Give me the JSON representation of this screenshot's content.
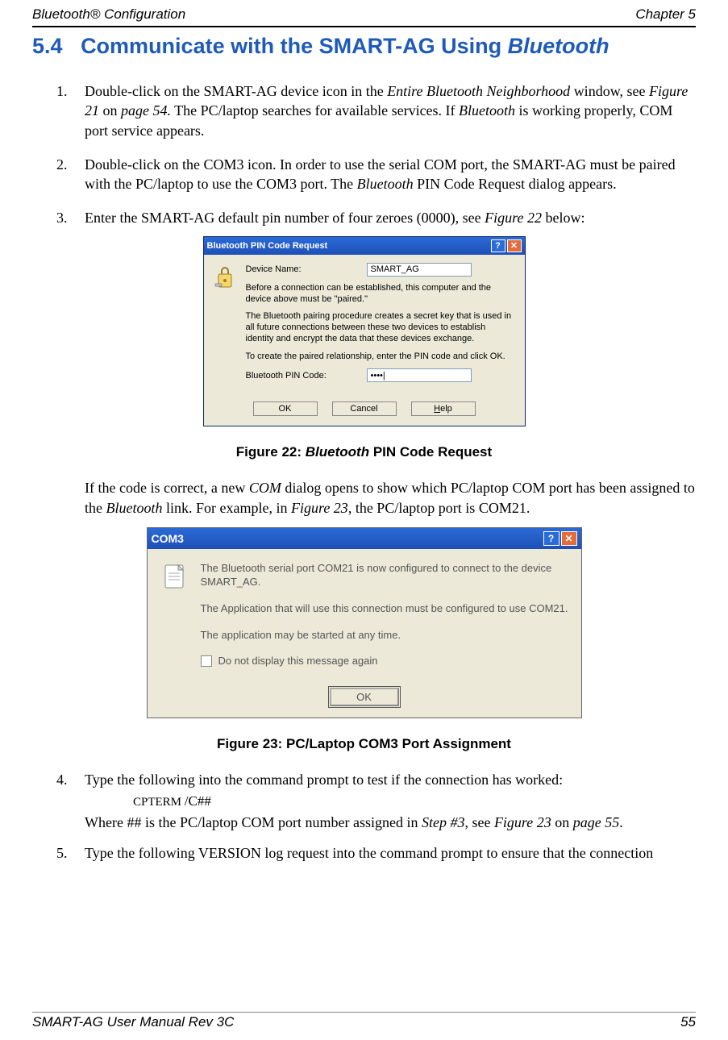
{
  "header": {
    "left": "Bluetooth® Configuration",
    "right": "Chapter 5"
  },
  "section": {
    "number": "5.4",
    "title_plain": "Communicate with the SMART-AG Using ",
    "title_italic": "Bluetooth"
  },
  "steps": {
    "s1": {
      "num": "1.",
      "pre": "Double-click on the SMART-AG device icon in the ",
      "it1": "Entire Bluetooth Neighborhood",
      "mid1": " window, see ",
      "it2": "Figure 21",
      "mid2": " on ",
      "it3": "page 54.",
      "mid3": " The PC/laptop searches for available services. If ",
      "it4": "Bluetooth",
      "post": " is working properly, COM port service appears."
    },
    "s2": {
      "num": "2.",
      "pre": "Double-click on the COM3 icon. In order to use the serial COM port, the SMART-AG must be paired with the PC/laptop to use the COM3 port. The ",
      "it1": "Bluetooth",
      "post": " PIN Code Request dialog appears."
    },
    "s3": {
      "num": "3.",
      "pre": "Enter the SMART-AG default pin number of four zeroes (0000), see ",
      "it1": "Figure 22",
      "post": " below:"
    },
    "s4": {
      "num": "4.",
      "text": "Type the following into the command prompt to test if the connection has worked:",
      "cmd_small": "CPTERM ",
      "cmd_rest": "/C##",
      "where_pre": "Where ## is the PC/laptop COM port number assigned in ",
      "where_it1": "Step #3",
      "where_mid": ", see ",
      "where_it2": "Figure 23",
      "where_mid2": " on ",
      "where_it3": "page 55",
      "where_post": "."
    },
    "s5": {
      "num": "5.",
      "text": "Type the following VERSION log request into the command prompt to ensure that the connection"
    }
  },
  "after_fig22": {
    "pre": "If the code is correct, a new ",
    "it1": "COM",
    "mid1": " dialog opens to show which PC/laptop COM port has been assigned to the ",
    "it2": "Bluetooth",
    "mid2": " link. For example, in ",
    "it3": "Figure 23",
    "post": ", the PC/laptop port is COM21."
  },
  "fig22": {
    "caption_pre": "Figure 22: ",
    "caption_it": "Bluetooth",
    "caption_post": " PIN Code Request",
    "dialog": {
      "title": "Bluetooth PIN Code Request",
      "device_name_label": "Device Name:",
      "device_name_value": "SMART_AG",
      "para1": "Before a connection can be established, this computer and the device above must be \"paired.\"",
      "para2": "The Bluetooth pairing procedure creates a secret key that is used in all future connections between these two devices to establish identity and encrypt the data that these devices exchange.",
      "para3": "To create the paired relationship, enter the PIN code and click OK.",
      "pin_label": "Bluetooth PIN Code:",
      "pin_value": "••••|",
      "ok": "OK",
      "cancel": "Cancel",
      "help_u": "H",
      "help_rest": "elp"
    }
  },
  "fig23": {
    "caption": "Figure 23: PC/Laptop COM3 Port Assignment",
    "dialog": {
      "title": "COM3",
      "para1": "The Bluetooth serial port COM21 is now configured to connect to the device SMART_AG.",
      "para2": "The Application that will use this connection must be configured to use COM21.",
      "para3": "The application may be started at any time.",
      "chk": "Do not display this message again",
      "ok": "OK"
    }
  },
  "footer": {
    "left": "SMART-AG User Manual Rev 3C",
    "right": "55"
  }
}
